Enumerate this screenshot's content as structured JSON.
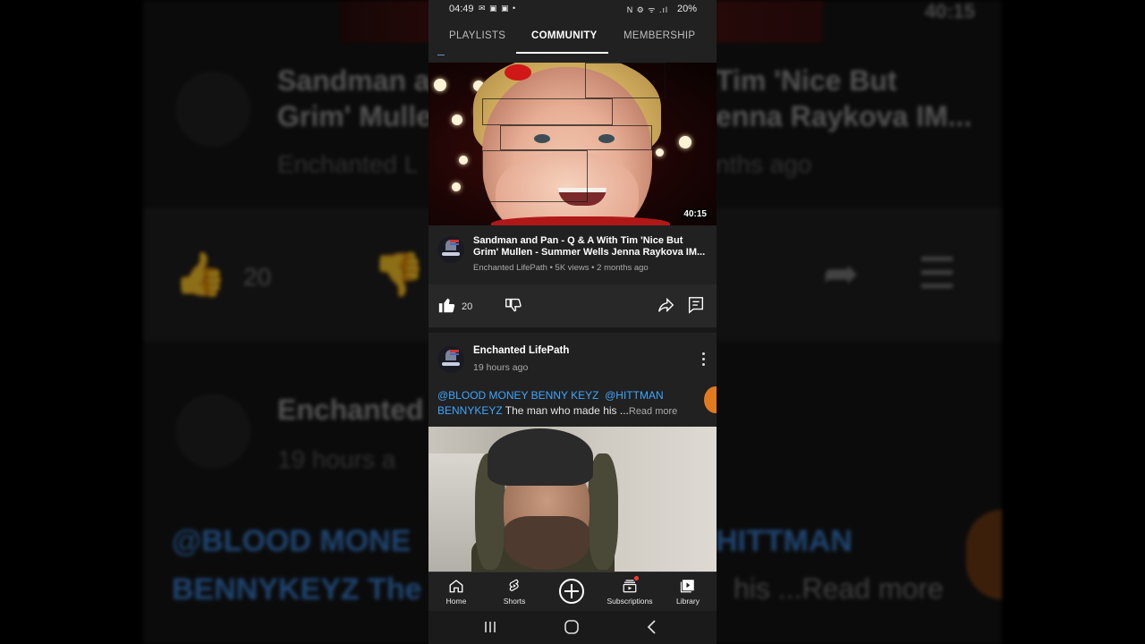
{
  "background": {
    "channel_line1": "Sandman a",
    "channel_line1_right": "Tim 'Nice But",
    "channel_line2": "Grim' Mullen",
    "channel_line2_right": "enna Raykova IM...",
    "meta_left": "Enchanted L",
    "meta_right": "nths ago",
    "duration": "40:15",
    "like_count": "20",
    "post_channel": "Enchanted",
    "post_time": "19 hours a",
    "mention_left": "@BLOOD MONE",
    "mention_right": "HITTMAN",
    "line3_left": "BENNYKEYZ The",
    "line3_right": "his ...Read more"
  },
  "status_bar": {
    "time": "04:49",
    "left_icons": "✉ ▣ ▣ •",
    "right_icons": "N ⚙ ᯤ .ıl",
    "battery": "20%"
  },
  "tabs": [
    {
      "label": "PLAYLISTS"
    },
    {
      "label": "COMMUNITY"
    },
    {
      "label": "MEMBERSHIP"
    }
  ],
  "video_post": {
    "duration": "40:15",
    "title": "Sandman and Pan - Q & A With Tim 'Nice But Grim' Mullen - Summer Wells Jenna Raykova IM...",
    "meta": "Enchanted LifePath • 5K views • 2 months ago",
    "like_count": "20"
  },
  "community_post": {
    "channel": "Enchanted LifePath",
    "time": "19 hours ago",
    "mention1": "@BLOOD MONEY BENNY KEYZ",
    "mention2": "@HITTMAN BENNYKEYZ",
    "text": " The man who made his ...",
    "read_more": "Read more"
  },
  "bottom_nav": [
    {
      "label": "Home",
      "icon": "home-icon"
    },
    {
      "label": "Shorts",
      "icon": "shorts-icon"
    },
    {
      "label": "",
      "icon": "create-icon"
    },
    {
      "label": "Subscriptions",
      "icon": "subscriptions-icon"
    },
    {
      "label": "Library",
      "icon": "library-icon"
    }
  ],
  "colors": {
    "accent_link": "#3ea6ff",
    "background": "#212121",
    "notification": "#ff3b30"
  }
}
